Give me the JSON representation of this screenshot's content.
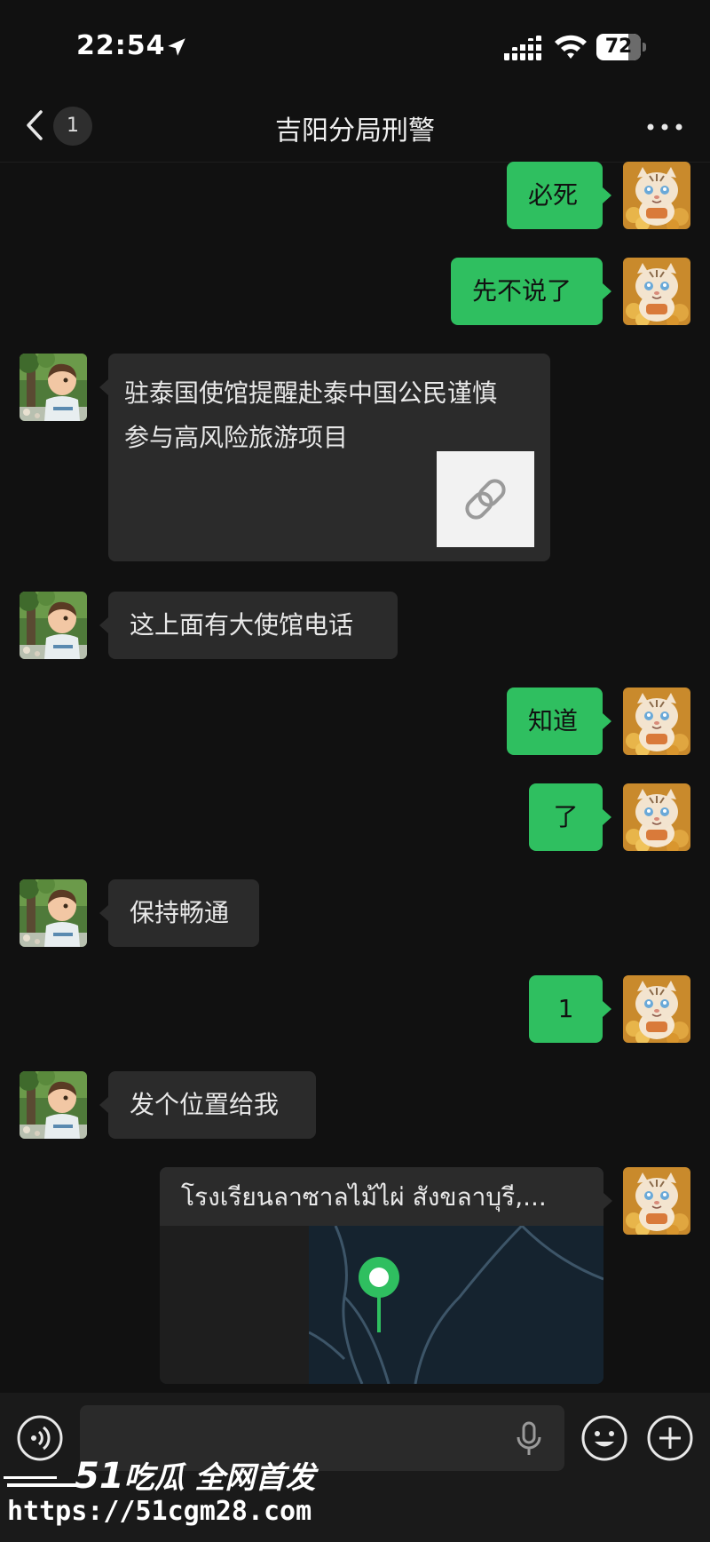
{
  "status_bar": {
    "time": "22:54",
    "battery": "72",
    "battery_level": 0.72
  },
  "nav": {
    "badge": "1",
    "title": "吉阳分局刑警"
  },
  "messages": [
    {
      "side": "me",
      "text": "必死"
    },
    {
      "side": "me",
      "text": "先不说了"
    },
    {
      "side": "them",
      "type": "link",
      "text": "驻泰国使馆提醒赴泰中国公民谨慎参与高风险旅游项目"
    },
    {
      "side": "them",
      "text": "这上面有大使馆电话"
    },
    {
      "side": "me",
      "text": "知道"
    },
    {
      "side": "me",
      "text": "了"
    },
    {
      "side": "them",
      "text": "保持畅通"
    },
    {
      "side": "me",
      "text": "1"
    },
    {
      "side": "them",
      "text": "发个位置给我"
    },
    {
      "side": "me",
      "type": "location",
      "text": "โรงเรียนลาซาลไม้ไผ่ สังขลาบุรี,..."
    }
  ],
  "input_bar": {
    "value": ""
  },
  "watermark": {
    "brand_num": "51",
    "brand_text": "吃瓜 全网首发",
    "url": "https://51cgm28.com"
  },
  "colors": {
    "my_bubble": "#2fbf60",
    "their_bubble": "#2b2b2b",
    "background": "#111111",
    "map_pin": "#2fbf60"
  }
}
